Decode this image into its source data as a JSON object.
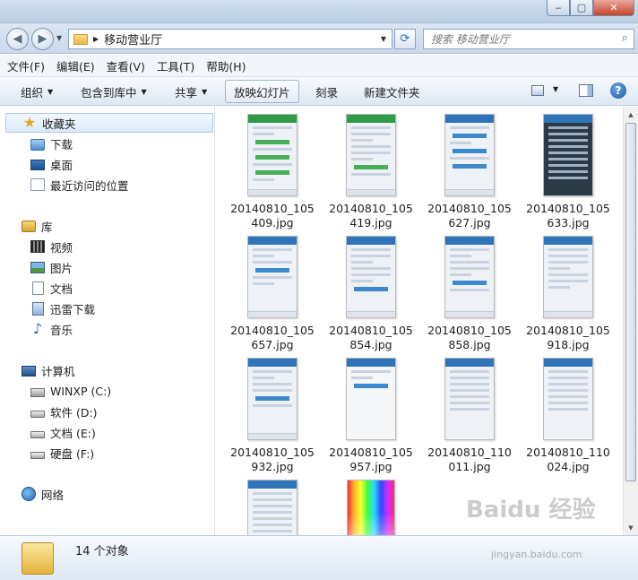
{
  "window": {
    "buttons": {
      "minimize": "‒",
      "maximize": "▢",
      "close": "✕"
    }
  },
  "address": {
    "path": "移动营业厅",
    "search_placeholder": "搜索 移动营业厅"
  },
  "menu": [
    "文件(F)",
    "编辑(E)",
    "查看(V)",
    "工具(T)",
    "帮助(H)"
  ],
  "toolbar": {
    "organize": "组织",
    "include_in_library": "包含到库中",
    "share": "共享",
    "slideshow": "放映幻灯片",
    "burn": "刻录",
    "new_folder": "新建文件夹"
  },
  "nav": {
    "favorites": "收藏夹",
    "downloads": "下载",
    "desktop": "桌面",
    "recent": "最近访问的位置",
    "libraries": "库",
    "videos": "视频",
    "pictures": "图片",
    "documents": "文档",
    "xunlei": "迅雷下载",
    "music": "音乐",
    "computer": "计算机",
    "drive_c": "WINXP (C:)",
    "drive_d": "软件 (D:)",
    "drive_e": "文档 (E:)",
    "drive_f": "硬盘 (F:)",
    "network": "网络"
  },
  "files": [
    {
      "name": "20140810_105409.jpg",
      "thumb": "green-list"
    },
    {
      "name": "20140810_105419.jpg",
      "thumb": "green-form"
    },
    {
      "name": "20140810_105627.jpg",
      "thumb": "icons"
    },
    {
      "name": "20140810_105633.jpg",
      "thumb": "dark-grid"
    },
    {
      "name": "20140810_105657.jpg",
      "thumb": "blue-form"
    },
    {
      "name": "20140810_105854.jpg",
      "thumb": "blue-form"
    },
    {
      "name": "20140810_105858.jpg",
      "thumb": "blue-form"
    },
    {
      "name": "20140810_105918.jpg",
      "thumb": "blue-form"
    },
    {
      "name": "20140810_105932.jpg",
      "thumb": "blue-form"
    },
    {
      "name": "20140810_105957.jpg",
      "thumb": "blue-form"
    },
    {
      "name": "20140810_110011.jpg",
      "thumb": "blue-list"
    },
    {
      "name": "20140810_110024.jpg",
      "thumb": "blue-list"
    },
    {
      "name": "",
      "thumb": "blue-list"
    },
    {
      "name": "",
      "thumb": "rainbow"
    }
  ],
  "status": {
    "count": "14 个对象"
  },
  "watermark": {
    "text": "Baidu 经验",
    "url": "jingyan.baidu.com"
  }
}
